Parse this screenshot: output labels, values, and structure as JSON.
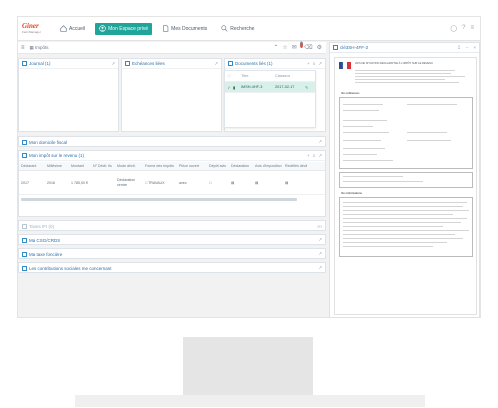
{
  "nav": {
    "logo_line1": "Giner",
    "logo_line2": "FarmManager",
    "items": [
      {
        "label": "Accueil",
        "icon": "home-icon"
      },
      {
        "label": "Mon Espace privé",
        "icon": "person-icon"
      },
      {
        "label": "Mes Documents",
        "icon": "document-icon"
      },
      {
        "label": "Recherche",
        "icon": "search-icon"
      }
    ],
    "right_icons": [
      "bell-icon",
      "help-icon",
      "menu-icon"
    ]
  },
  "toolbar": {
    "imports_label": "Impôts",
    "notification_count": "8"
  },
  "widgets": {
    "journal": {
      "title": "Journal (1)"
    },
    "echeances": {
      "title": "Echéances liées"
    },
    "documents_lies": {
      "title": "Documents liés (1)",
      "columns": [
        "Titre",
        "Classeur"
      ],
      "rows": [
        {
          "title": "IMSH-4HF-3",
          "classeur": "2017-02-17"
        }
      ]
    },
    "domicile": {
      "title": "Mon domicile fiscal"
    },
    "revenus": {
      "title": "Mon impôt sur le revenu (1)",
      "columns": [
        "Déclarant",
        "Millésime",
        "Montant",
        "N° Déclt. fis",
        "Mode déclt.",
        "Forme des Impôts",
        "Pièce ouvert",
        "Dépôt avis",
        "Déclaration",
        "Avis d'imposition",
        "Rectifiés déclt"
      ],
      "row": [
        "2017",
        "2016",
        "1 785,00 €",
        "",
        "Déclaration",
        "TRAVAUX",
        "avec",
        "",
        "",
        "",
        ""
      ],
      "row_sub": "centre"
    },
    "taxes_ifi": {
      "title": "Taxes IFI (0)",
      "tag": "IFI"
    },
    "csg": {
      "title": "Ma CSG/CRDS"
    },
    "taxe_fonciere": {
      "title": "Ma taxe foncière"
    },
    "contributions": {
      "title": "Les contributions sociales me concernant"
    }
  },
  "preview": {
    "title": "clé3SH-4FF-3",
    "header_text": "AVIS DE SITUATION DÉCLARATIVE À L'IMPÔT SUR LE REVENU",
    "section": "Vos références",
    "footer_note": "Vos informations"
  }
}
